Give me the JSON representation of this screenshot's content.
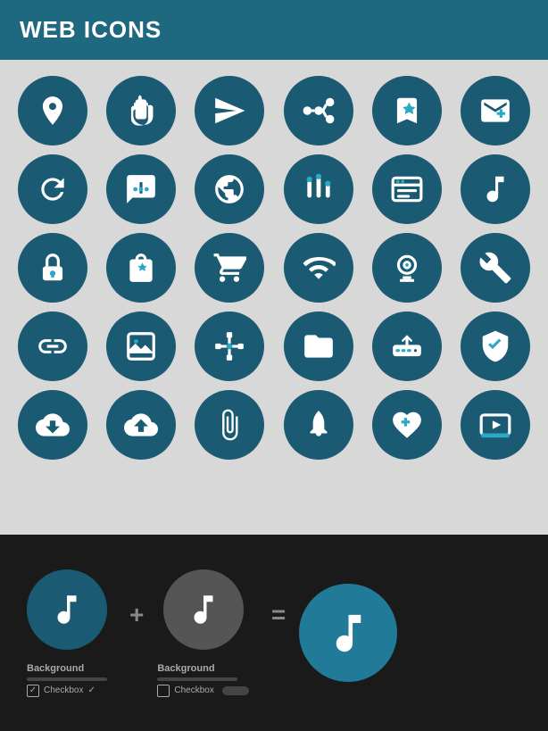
{
  "header": {
    "title": "WEB ICONS"
  },
  "icons": {
    "rows": [
      [
        "location-pin",
        "stop-hand",
        "paper-plane",
        "nodes",
        "bookmark",
        "mail-plus"
      ],
      [
        "refresh",
        "chat-bubble",
        "globe",
        "equalizer",
        "browser",
        "music-note"
      ],
      [
        "lock",
        "shopping-bag",
        "cart",
        "wifi",
        "webcam",
        "wrench"
      ],
      [
        "link",
        "image",
        "network",
        "folder",
        "router",
        "shield"
      ],
      [
        "cloud-download",
        "cloud-upload",
        "paperclip",
        "rocket",
        "heart-plus",
        "video-play"
      ]
    ]
  },
  "bottom": {
    "label1": "Background",
    "label2": "Background",
    "checkbox1": "Checkbox",
    "checkbox2": "Checkbox",
    "operator_plus": "+",
    "operator_equals": "="
  }
}
